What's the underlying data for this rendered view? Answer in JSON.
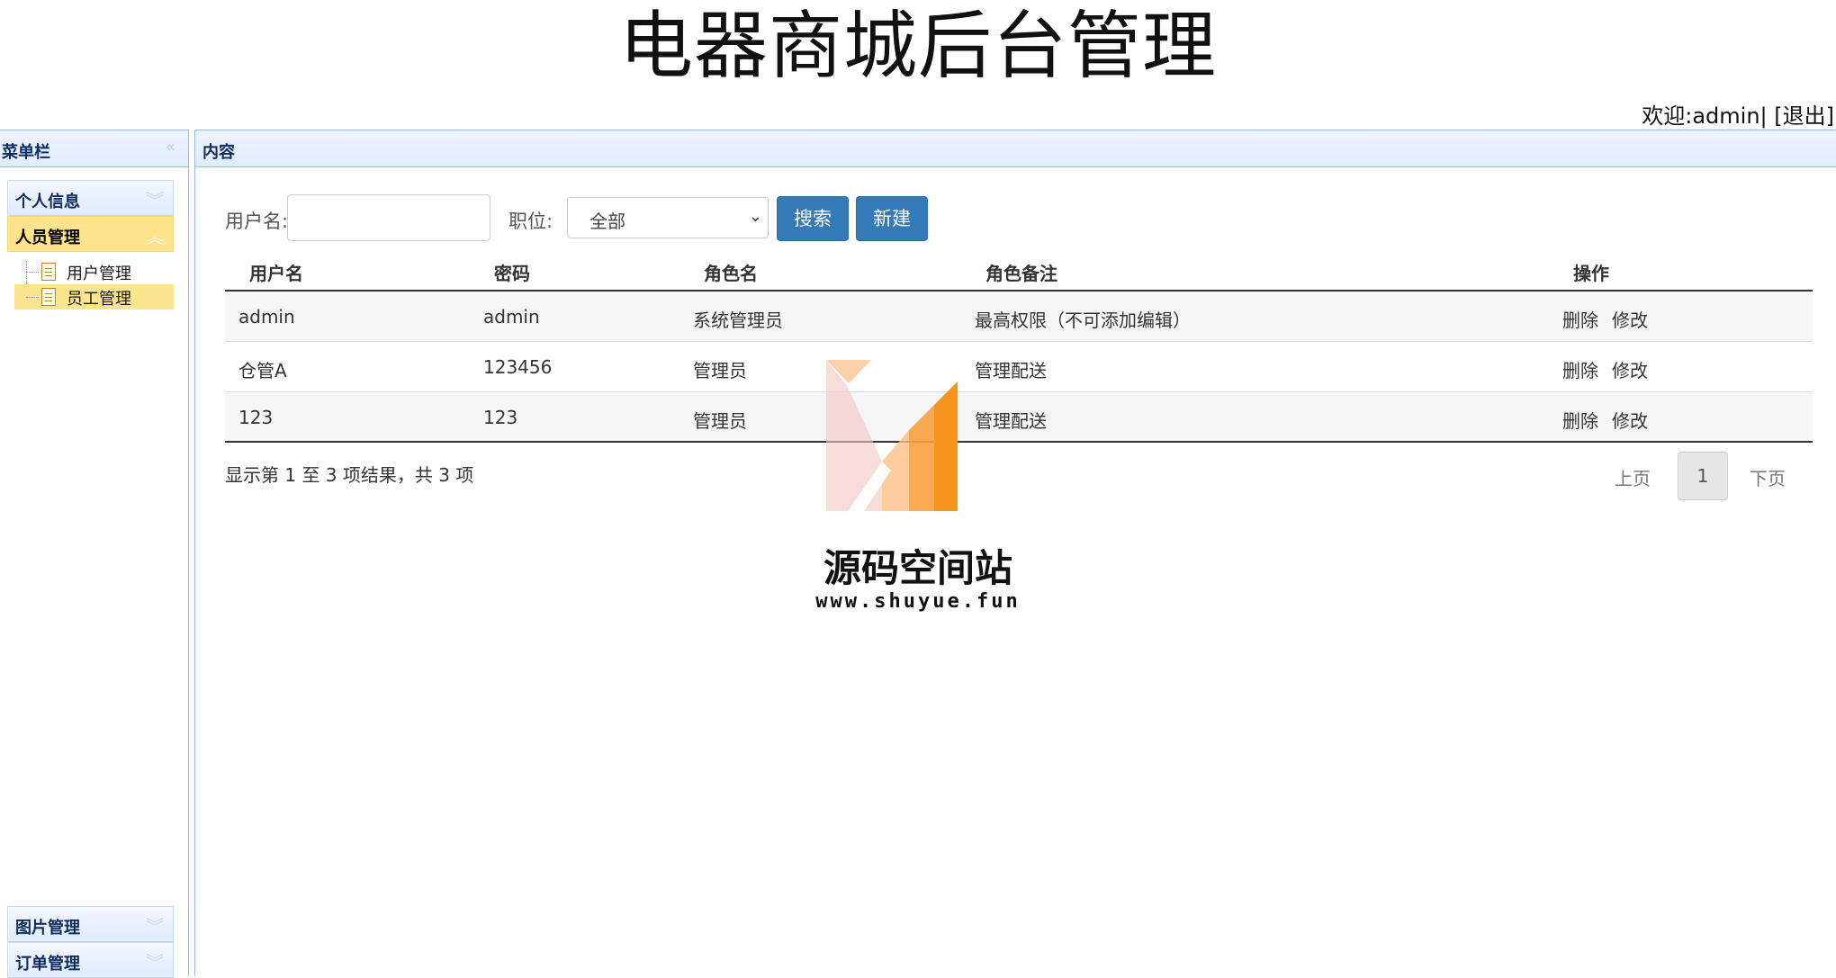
{
  "header": {
    "title": "电器商城后台管理",
    "welcome_prefix": "欢迎:",
    "username": "admin",
    "separator": "|",
    "logout": "[退出]"
  },
  "left_panel": {
    "title": "菜单栏",
    "collapse_icon": "double-chevron-left-icon",
    "menus": [
      {
        "label": "个人信息"
      },
      {
        "label": "人员管理",
        "active": true,
        "items": [
          {
            "label": "用户管理"
          },
          {
            "label": "员工管理",
            "selected": true
          }
        ]
      },
      {
        "label": "图片管理"
      },
      {
        "label": "订单管理"
      }
    ]
  },
  "content": {
    "title": "内容",
    "search": {
      "username_label": "用户名:",
      "username_value": "",
      "position_label": "职位:",
      "position_selected": "全部",
      "search_button": "搜索",
      "new_button": "新建"
    },
    "table": {
      "columns": [
        "用户名",
        "密码",
        "角色名",
        "角色备注",
        "操作"
      ],
      "rows": [
        {
          "username": "admin",
          "password": "admin",
          "role": "系统管理员",
          "note": "最高权限（不可添加编辑）"
        },
        {
          "username": "仓管A",
          "password": "123456",
          "role": "管理员",
          "note": "管理配送"
        },
        {
          "username": "123",
          "password": "123",
          "role": "管理员",
          "note": "管理配送"
        }
      ],
      "delete_label": "删除",
      "edit_label": "修改"
    },
    "summary": "显示第 1 至 3 项结果，共 3 项",
    "pager": {
      "prev": "上页",
      "current": "1",
      "next": "下页"
    }
  },
  "watermark": {
    "title": "源码空间站",
    "url": "www.shuyue.fun"
  },
  "colors": {
    "panel_border": "#95b8e7",
    "accordion_active": "#ffe48d",
    "button_primary": "#337ab7",
    "logo_orange": "#f7941d"
  }
}
